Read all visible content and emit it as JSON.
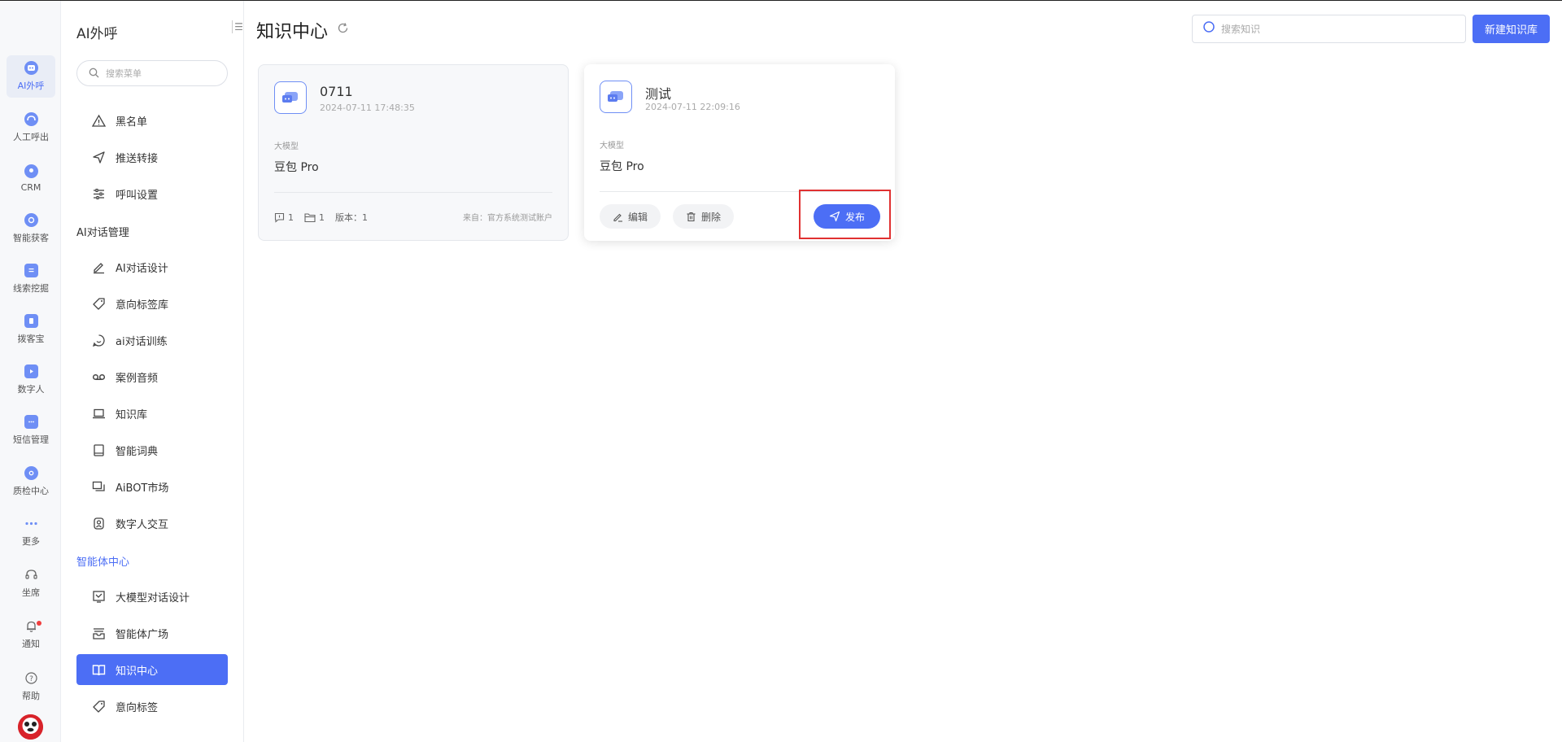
{
  "rail": {
    "items": [
      {
        "label": "AI外呼",
        "icon": "robot-icon"
      },
      {
        "label": "人工呼出",
        "icon": "headset-icon"
      },
      {
        "label": "CRM",
        "icon": "crm-icon"
      },
      {
        "label": "智能获客",
        "icon": "target-icon"
      },
      {
        "label": "线索挖掘",
        "icon": "clipboard-icon"
      },
      {
        "label": "拨客宝",
        "icon": "phone-icon"
      },
      {
        "label": "数字人",
        "icon": "tv-icon"
      },
      {
        "label": "短信管理",
        "icon": "message-icon"
      },
      {
        "label": "质检中心",
        "icon": "shield-icon"
      },
      {
        "label": "更多",
        "icon": "more-icon"
      },
      {
        "label": "坐席",
        "icon": "headphones-icon"
      },
      {
        "label": "通知",
        "icon": "bell-icon"
      },
      {
        "label": "帮助",
        "icon": "help-icon"
      }
    ]
  },
  "menu": {
    "title": "AI外呼",
    "search_placeholder": "搜索菜单",
    "items": [
      {
        "label": "黑名单",
        "icon": "warning-icon"
      },
      {
        "label": "推送转接",
        "icon": "send-icon"
      },
      {
        "label": "呼叫设置",
        "icon": "sliders-icon"
      },
      {
        "label": "AI对话设计",
        "icon": "pen-icon"
      },
      {
        "label": "意向标签库",
        "icon": "tag-icon"
      },
      {
        "label": "ai对话训练",
        "icon": "chat-icon"
      },
      {
        "label": "案例音频",
        "icon": "voicemail-icon"
      },
      {
        "label": "知识库",
        "icon": "laptop-icon"
      },
      {
        "label": "智能词典",
        "icon": "book-icon"
      },
      {
        "label": "AiBOT市场",
        "icon": "windows-icon"
      },
      {
        "label": "数字人交互",
        "icon": "avatar-icon"
      },
      {
        "label": "大模型对话设计",
        "icon": "chart-icon"
      },
      {
        "label": "智能体广场",
        "icon": "archive-icon"
      },
      {
        "label": "知识中心",
        "icon": "open-book-icon"
      },
      {
        "label": "意向标签",
        "icon": "tag-icon"
      }
    ],
    "groups": [
      "AI对话管理",
      "智能体中心"
    ]
  },
  "main": {
    "title": "知识中心",
    "search_placeholder": "搜索知识",
    "new_button": "新建知识库",
    "cards": [
      {
        "name": "0711",
        "time": "2024-07-11 17:48:35",
        "model_label": "大模型",
        "model": "豆包 Pro",
        "stat_questions": "1",
        "stat_folders": "1",
        "version": "版本：1",
        "source": "来自：官方系统测试账户"
      },
      {
        "name": "测试",
        "time": "2024-07-11 22:09:16",
        "model_label": "大模型",
        "model": "豆包 Pro",
        "edit_label": "编辑",
        "delete_label": "删除",
        "publish_label": "发布"
      }
    ]
  },
  "colors": {
    "accent": "#4c6ef5",
    "highlight": "#e03131"
  }
}
